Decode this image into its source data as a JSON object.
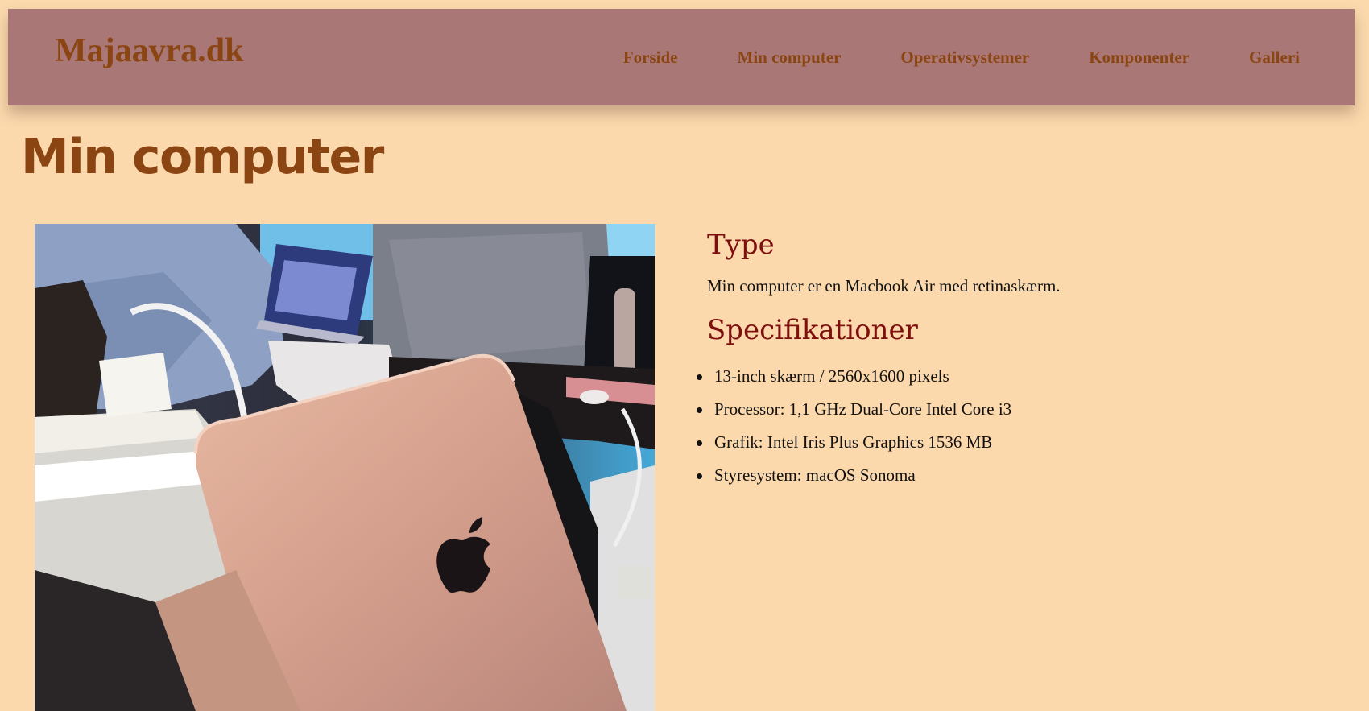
{
  "header": {
    "logo": "Majaavra.dk",
    "nav": [
      {
        "label": "Forside"
      },
      {
        "label": "Min computer"
      },
      {
        "label": "Operativsystemer"
      },
      {
        "label": "Komponenter"
      },
      {
        "label": "Galleri"
      }
    ]
  },
  "main": {
    "title": "Min computer",
    "type_heading": "Type",
    "type_text": "Min computer er en Macbook Air med retinaskærm.",
    "spec_heading": "Specifikationer",
    "specs": [
      "13-inch skærm / 2560x1600 pixels",
      "Processor: 1,1 GHz Dual-Core Intel Core i3",
      "Grafik: Intel Iris Plus Graphics 1536 MB",
      "Styresystem: macOS Sonoma"
    ]
  },
  "colors": {
    "page_background": "#fbd9ad",
    "navbar_background": "#a97775",
    "brand_brown": "#8b4513",
    "heading_red": "#7f0f0f"
  },
  "icons": {
    "photo_logo": "apple-logo-icon"
  }
}
